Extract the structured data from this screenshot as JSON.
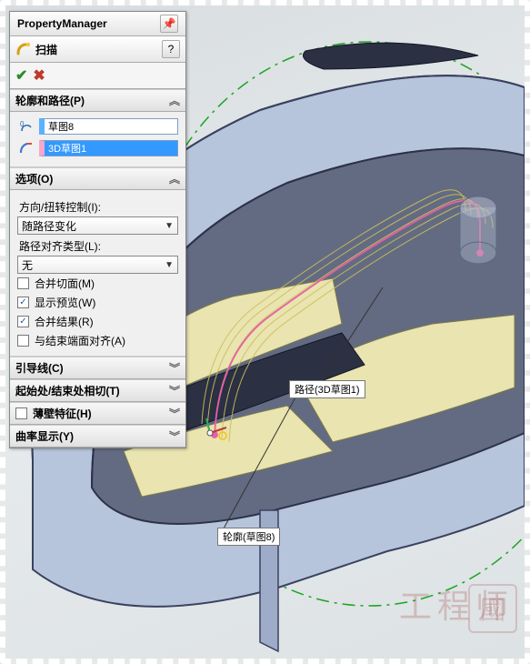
{
  "panel": {
    "title": "PropertyManager",
    "feature_name": "扫描",
    "ok_glyph": "✔",
    "cancel_glyph": "✖",
    "pin_glyph": "📌",
    "help_glyph": "?"
  },
  "sections": {
    "profile_path": {
      "header": "轮廓和路径(P)",
      "profile_value": "草图8",
      "path_value": "3D草图1"
    },
    "options": {
      "header": "选项(O)",
      "orient_label": "方向/扭转控制(I):",
      "orient_value": "随路径变化",
      "align_label": "路径对齐类型(L):",
      "align_value": "无",
      "merge_tangent": {
        "label": "合并切面(M)",
        "checked": false
      },
      "show_preview": {
        "label": "显示预览(W)",
        "checked": true
      },
      "merge_result": {
        "label": "合并结果(R)",
        "checked": true
      },
      "align_end": {
        "label": "与结束端面对齐(A)",
        "checked": false
      }
    },
    "guide": {
      "header": "引导线(C)"
    },
    "start_end": {
      "header": "起始处/结束处相切(T)"
    },
    "thin": {
      "header": "薄壁特征(H)",
      "checked": false
    },
    "curvature": {
      "header": "曲率显示(Y)"
    }
  },
  "callouts": {
    "path": "路径(3D草图1)",
    "profile": "轮廓(草图8)"
  },
  "watermark": "工程师",
  "watermark_stamp": "國"
}
